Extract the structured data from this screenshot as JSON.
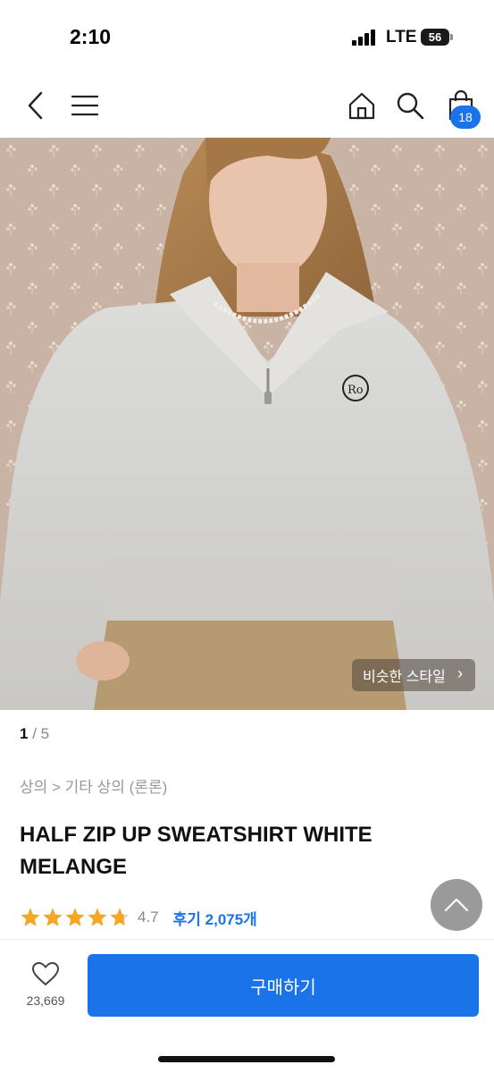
{
  "status": {
    "time": "2:10",
    "network": "LTE",
    "battery": "56"
  },
  "nav": {
    "cart_count": "18"
  },
  "hero": {
    "similar_style_label": "비슷한 스타일",
    "similar_style_chevron": "›"
  },
  "pager": {
    "current": "1",
    "separator": " / ",
    "total": "5"
  },
  "breadcrumb": "상의 > 기타 상의 (론론)",
  "product": {
    "title": "HALF ZIP UP SWEATSHIRT WHITE MELANGE",
    "rating": "4.7",
    "review_label": "후기 2,075개",
    "stars": 4.7
  },
  "bottom": {
    "like_count": "23,669",
    "buy_label": "구매하기"
  },
  "colors": {
    "accent": "#1a73e8",
    "star": "#f5a623"
  },
  "icons": [
    "back-icon",
    "hamburger-menu-icon",
    "home-icon",
    "search-icon",
    "shopping-bag-icon",
    "heart-icon",
    "chevron-up-icon",
    "signal-icon",
    "battery-icon"
  ]
}
